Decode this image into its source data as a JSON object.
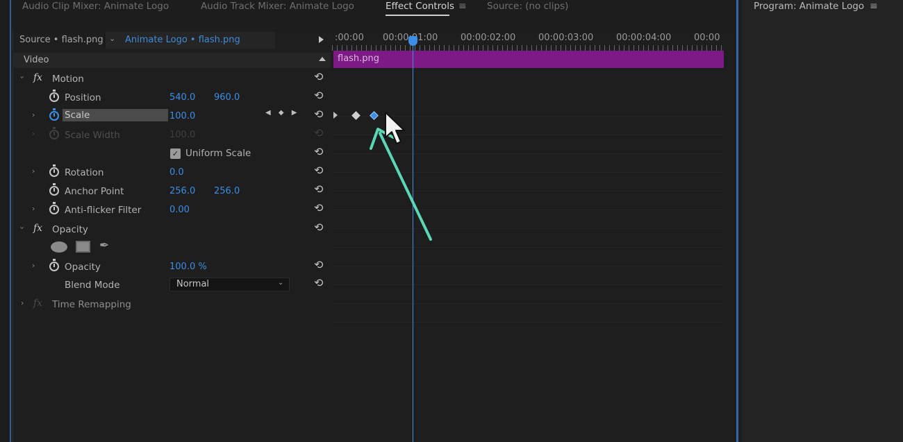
{
  "tabs": [
    {
      "label": "Audio Clip Mixer: Animate Logo",
      "active": false
    },
    {
      "label": "Audio Track Mixer: Animate Logo",
      "active": false
    },
    {
      "label": "Effect Controls",
      "active": true
    },
    {
      "label": "Source: (no clips)",
      "active": false
    }
  ],
  "program": {
    "title": "Program: Animate Logo"
  },
  "source": {
    "label": "Source • flash.png",
    "sequence": "Animate Logo • flash.png"
  },
  "video_header": "Video",
  "motion": {
    "label": "Motion",
    "position": {
      "label": "Position",
      "x": "540.0",
      "y": "960.0"
    },
    "scale": {
      "label": "Scale",
      "value": "100.0"
    },
    "scale_width": {
      "label": "Scale Width",
      "value": "100.0"
    },
    "uniform_scale": {
      "label": "Uniform Scale",
      "checked": true
    },
    "rotation": {
      "label": "Rotation",
      "value": "0.0"
    },
    "anchor_point": {
      "label": "Anchor Point",
      "x": "256.0",
      "y": "256.0"
    },
    "anti_flicker": {
      "label": "Anti-flicker Filter",
      "value": "0.00"
    }
  },
  "opacity": {
    "label": "Opacity",
    "opacity_prop": {
      "label": "Opacity",
      "value": "100.0 %"
    },
    "blend_mode": {
      "label": "Blend Mode",
      "value": "Normal"
    }
  },
  "time_remapping": {
    "label": "Time Remapping"
  },
  "timeline": {
    "ruler": [
      ":00:00",
      "00:00:01:00",
      "00:00:02:00",
      "00:00:03:00",
      "00:00:04:00",
      "00:00"
    ],
    "clip": "flash.png"
  },
  "icons": {
    "reset": "reset-icon",
    "stopwatch": "stopwatch-icon",
    "menu": "hamburger-menu-icon",
    "cursor": "mouse-pointer-icon"
  },
  "colors": {
    "accent_blue": "#3b8fe6",
    "clip_purple": "#7d1a86",
    "annotation_arrow": "#5ad7b6"
  }
}
